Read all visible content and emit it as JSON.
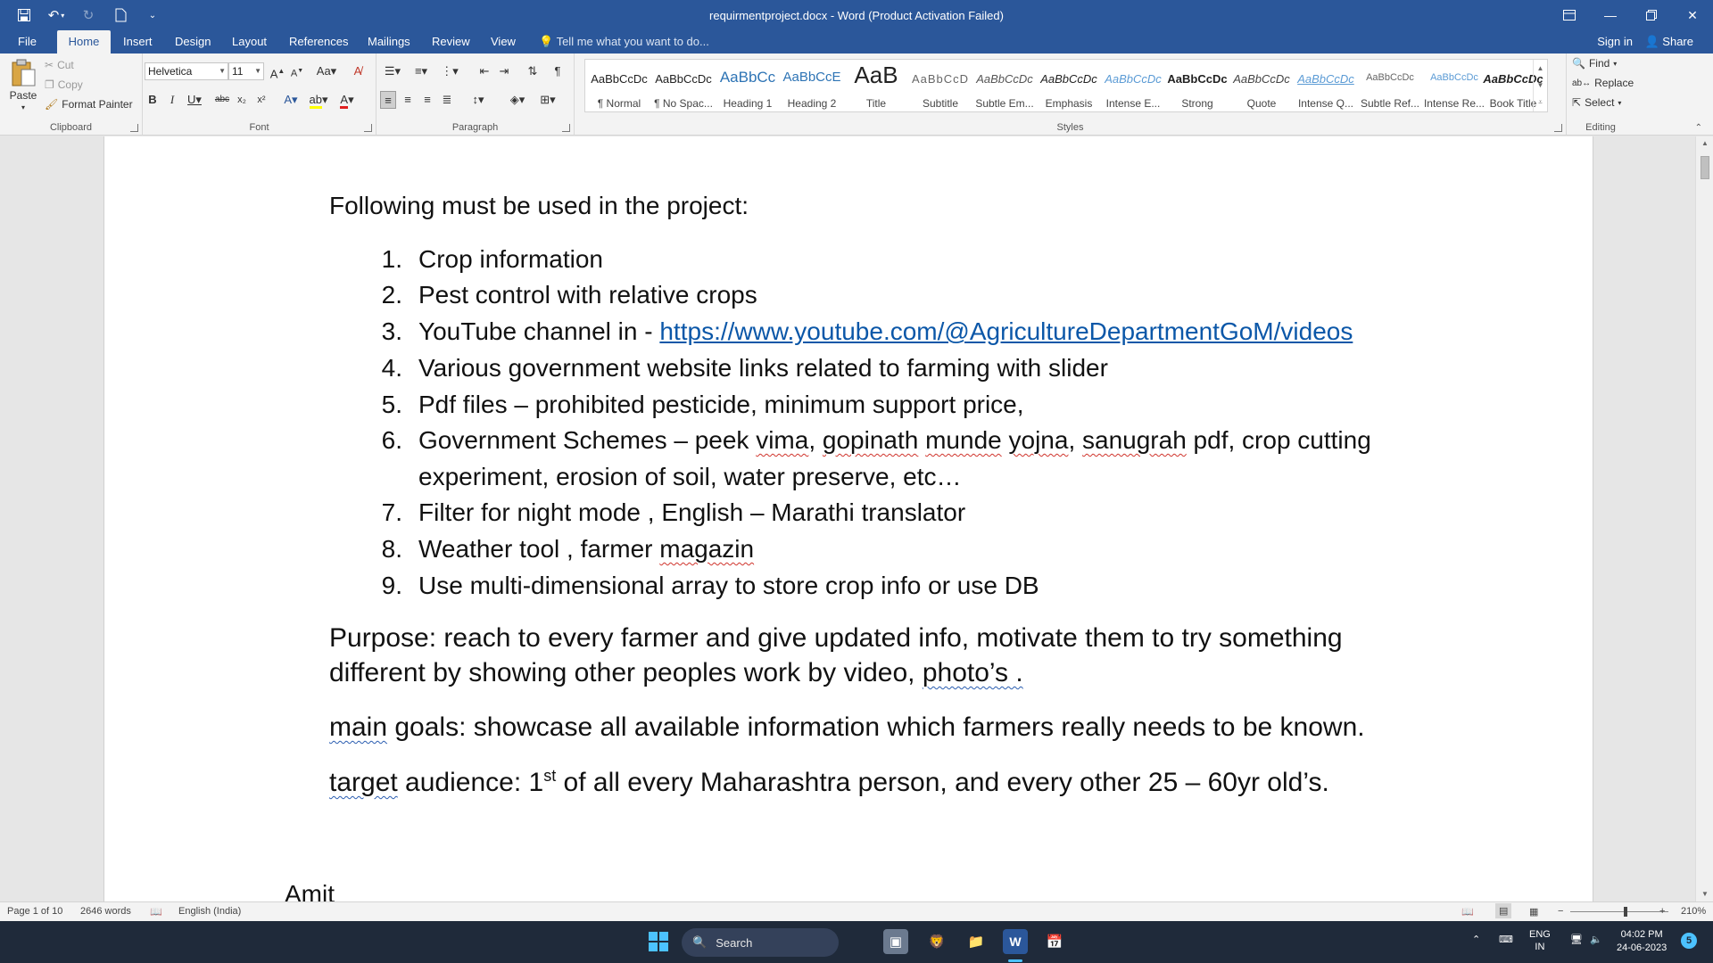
{
  "app": {
    "title": "requirmentproject.docx - Word (Product Activation Failed)"
  },
  "tabs": [
    "File",
    "Home",
    "Insert",
    "Design",
    "Layout",
    "References",
    "Mailings",
    "Review",
    "View"
  ],
  "tell_me": "Tell me what you want to do...",
  "sign_in": "Sign in",
  "share": "Share",
  "clipboard": {
    "paste": "Paste",
    "cut": "Cut",
    "copy": "Copy",
    "format_painter": "Format Painter",
    "label": "Clipboard"
  },
  "font": {
    "name": "Helvetica",
    "size": "11",
    "label": "Font"
  },
  "paragraph": {
    "label": "Paragraph"
  },
  "styles": {
    "label": "Styles",
    "items": [
      {
        "preview": "AaBbCcDc",
        "name": "¶ Normal"
      },
      {
        "preview": "AaBbCcDc",
        "name": "¶ No Spac..."
      },
      {
        "preview": "AaBbCc",
        "name": "Heading 1"
      },
      {
        "preview": "AaBbCcE",
        "name": "Heading 2"
      },
      {
        "preview": "AaB",
        "name": "Title"
      },
      {
        "preview": "AaBbCcD",
        "name": "Subtitle"
      },
      {
        "preview": "AaBbCcDc",
        "name": "Subtle Em..."
      },
      {
        "preview": "AaBbCcDc",
        "name": "Emphasis"
      },
      {
        "preview": "AaBbCcDc",
        "name": "Intense E..."
      },
      {
        "preview": "AaBbCcDc",
        "name": "Strong"
      },
      {
        "preview": "AaBbCcDc",
        "name": "Quote"
      },
      {
        "preview": "AaBbCcDc",
        "name": "Intense Q..."
      },
      {
        "preview": "AaBbCcDc",
        "name": "Subtle Ref..."
      },
      {
        "preview": "AaBbCcDc",
        "name": "Intense Re..."
      },
      {
        "preview": "AaBbCcDc",
        "name": "Book Title"
      }
    ]
  },
  "editing": {
    "find": "Find",
    "replace": "Replace",
    "select": "Select",
    "label": "Editing"
  },
  "document": {
    "intro": "Following must be used in the project:",
    "list": [
      {
        "num": "1.",
        "text": "Crop information"
      },
      {
        "num": "2.",
        "text": "Pest control with relative crops"
      },
      {
        "num": "3.",
        "text": "YouTube channel in - ",
        "link": "https://www.youtube.com/@AgricultureDepartmentGoM/videos"
      },
      {
        "num": "4.",
        "text": "Various government website links related to farming with slider"
      },
      {
        "num": "5.",
        "text": "Pdf files – prohibited pesticide, minimum support price,"
      },
      {
        "num": "6.",
        "p1": "Government Schemes – peek ",
        "w1": "vima",
        "p2": ", ",
        "w2": "gopinath",
        "p3": " ",
        "w3": "munde",
        "p4": " ",
        "w4": "yojna",
        "p5": ", ",
        "w5": "sanugrah",
        "p6": " pdf, crop cutting",
        "line2": "experiment, erosion of soil, water preserve, etc…"
      },
      {
        "num": "7.",
        "text": "Filter for night mode , English – Marathi translator"
      },
      {
        "num": "8.",
        "p1": "Weather tool , farmer ",
        "w1": "magazin"
      },
      {
        "num": "9.",
        "text": "Use multi-dimensional array to store crop info or use  DB"
      }
    ],
    "purpose_line1": "Purpose: reach to every farmer and give updated info, motivate them to try something",
    "purpose_line2_a": "different by showing other peoples work by video, ",
    "purpose_line2_b": "photo’s .",
    "goals_a": "main",
    "goals_b": " goals: showcase all available information which farmers really needs to be known.",
    "target_a": "target",
    "target_b": " audience: 1",
    "target_sup": "st",
    "target_c": " of all every Maharashtra person, and every other 25 – 60yr old’s.",
    "next": "Amit"
  },
  "status": {
    "page": "Page 1 of 10",
    "words": "2646 words",
    "language": "English (India)",
    "zoom": "210%"
  },
  "taskbar": {
    "search": "Search",
    "lang1": "ENG",
    "lang2": "IN",
    "time": "04:02 PM",
    "date": "24-06-2023",
    "badge": "5"
  }
}
